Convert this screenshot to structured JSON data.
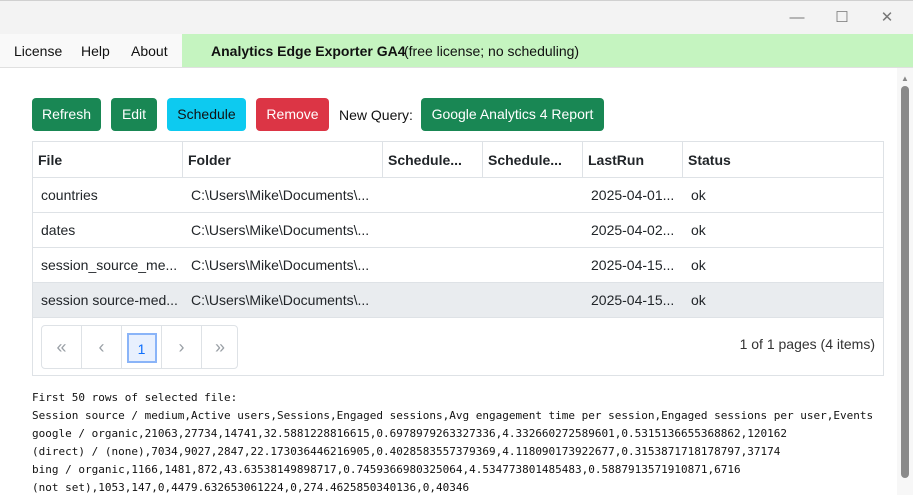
{
  "window": {
    "minimize": "—",
    "maximize": "☐",
    "close": "✕"
  },
  "menu": {
    "license": "License",
    "help": "Help",
    "about": "About"
  },
  "banner": {
    "title": "Analytics Edge Exporter GA4",
    "subtitle": "(free license; no scheduling)"
  },
  "toolbar": {
    "refresh": "Refresh",
    "edit": "Edit",
    "schedule": "Schedule",
    "remove": "Remove",
    "new_query_label": "New Query:",
    "ga4_report": "Google Analytics 4 Report"
  },
  "grid": {
    "columns": [
      "File",
      "Folder",
      "Schedule...",
      "Schedule...",
      "LastRun",
      "Status"
    ],
    "rows": [
      {
        "file": "countries",
        "folder": "C:\\Users\\Mike\\Documents\\...",
        "sched1": "",
        "sched2": "",
        "lastrun": "2025-04-01...",
        "status": "ok"
      },
      {
        "file": "dates",
        "folder": "C:\\Users\\Mike\\Documents\\...",
        "sched1": "",
        "sched2": "",
        "lastrun": "2025-04-02...",
        "status": "ok"
      },
      {
        "file": "session_source_me...",
        "folder": "C:\\Users\\Mike\\Documents\\...",
        "sched1": "",
        "sched2": "",
        "lastrun": "2025-04-15...",
        "status": "ok"
      },
      {
        "file": "session source-med...",
        "folder": "C:\\Users\\Mike\\Documents\\...",
        "sched1": "",
        "sched2": "",
        "lastrun": "2025-04-15...",
        "status": "ok"
      }
    ],
    "pager": {
      "first": "«",
      "prev": "‹",
      "current": "1",
      "next": "›",
      "last": "»"
    },
    "page_info": "1 of 1 pages (4 items)"
  },
  "preview": {
    "heading": "First 50 rows of selected file:",
    "lines": [
      "Session source / medium,Active users,Sessions,Engaged sessions,Avg engagement time per session,Engaged sessions per user,Events",
      "google / organic,21063,27734,14741,32.5881228816615,0.6978979263327336,4.332660272589601,0.5315136655368862,120162",
      "(direct) / (none),7034,9027,2847,22.173036446216905,0.4028583557379369,4.118090173922677,0.3153871718178797,37174",
      "bing / organic,1166,1481,872,43.63538149898717,0.7459366980325064,4.534773801485483,0.5887913571910871,6716",
      "(not set),1053,147,0,4479.632653061224,0,274.4625850340136,0,40346"
    ]
  }
}
